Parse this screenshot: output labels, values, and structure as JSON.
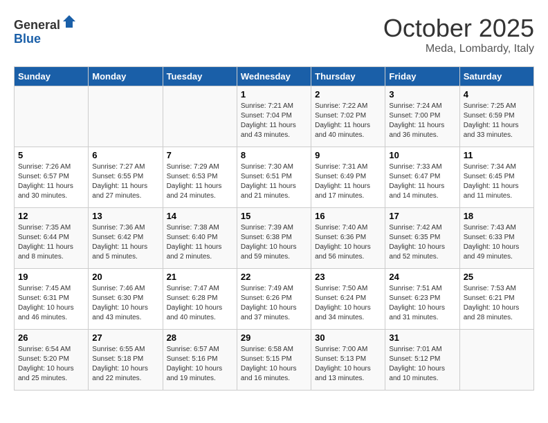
{
  "header": {
    "logo_line1": "General",
    "logo_line2": "Blue",
    "month": "October 2025",
    "location": "Meda, Lombardy, Italy"
  },
  "weekdays": [
    "Sunday",
    "Monday",
    "Tuesday",
    "Wednesday",
    "Thursday",
    "Friday",
    "Saturday"
  ],
  "weeks": [
    [
      {
        "num": "",
        "info": ""
      },
      {
        "num": "",
        "info": ""
      },
      {
        "num": "",
        "info": ""
      },
      {
        "num": "1",
        "info": "Sunrise: 7:21 AM\nSunset: 7:04 PM\nDaylight: 11 hours and 43 minutes."
      },
      {
        "num": "2",
        "info": "Sunrise: 7:22 AM\nSunset: 7:02 PM\nDaylight: 11 hours and 40 minutes."
      },
      {
        "num": "3",
        "info": "Sunrise: 7:24 AM\nSunset: 7:00 PM\nDaylight: 11 hours and 36 minutes."
      },
      {
        "num": "4",
        "info": "Sunrise: 7:25 AM\nSunset: 6:59 PM\nDaylight: 11 hours and 33 minutes."
      }
    ],
    [
      {
        "num": "5",
        "info": "Sunrise: 7:26 AM\nSunset: 6:57 PM\nDaylight: 11 hours and 30 minutes."
      },
      {
        "num": "6",
        "info": "Sunrise: 7:27 AM\nSunset: 6:55 PM\nDaylight: 11 hours and 27 minutes."
      },
      {
        "num": "7",
        "info": "Sunrise: 7:29 AM\nSunset: 6:53 PM\nDaylight: 11 hours and 24 minutes."
      },
      {
        "num": "8",
        "info": "Sunrise: 7:30 AM\nSunset: 6:51 PM\nDaylight: 11 hours and 21 minutes."
      },
      {
        "num": "9",
        "info": "Sunrise: 7:31 AM\nSunset: 6:49 PM\nDaylight: 11 hours and 17 minutes."
      },
      {
        "num": "10",
        "info": "Sunrise: 7:33 AM\nSunset: 6:47 PM\nDaylight: 11 hours and 14 minutes."
      },
      {
        "num": "11",
        "info": "Sunrise: 7:34 AM\nSunset: 6:45 PM\nDaylight: 11 hours and 11 minutes."
      }
    ],
    [
      {
        "num": "12",
        "info": "Sunrise: 7:35 AM\nSunset: 6:44 PM\nDaylight: 11 hours and 8 minutes."
      },
      {
        "num": "13",
        "info": "Sunrise: 7:36 AM\nSunset: 6:42 PM\nDaylight: 11 hours and 5 minutes."
      },
      {
        "num": "14",
        "info": "Sunrise: 7:38 AM\nSunset: 6:40 PM\nDaylight: 11 hours and 2 minutes."
      },
      {
        "num": "15",
        "info": "Sunrise: 7:39 AM\nSunset: 6:38 PM\nDaylight: 10 hours and 59 minutes."
      },
      {
        "num": "16",
        "info": "Sunrise: 7:40 AM\nSunset: 6:36 PM\nDaylight: 10 hours and 56 minutes."
      },
      {
        "num": "17",
        "info": "Sunrise: 7:42 AM\nSunset: 6:35 PM\nDaylight: 10 hours and 52 minutes."
      },
      {
        "num": "18",
        "info": "Sunrise: 7:43 AM\nSunset: 6:33 PM\nDaylight: 10 hours and 49 minutes."
      }
    ],
    [
      {
        "num": "19",
        "info": "Sunrise: 7:45 AM\nSunset: 6:31 PM\nDaylight: 10 hours and 46 minutes."
      },
      {
        "num": "20",
        "info": "Sunrise: 7:46 AM\nSunset: 6:30 PM\nDaylight: 10 hours and 43 minutes."
      },
      {
        "num": "21",
        "info": "Sunrise: 7:47 AM\nSunset: 6:28 PM\nDaylight: 10 hours and 40 minutes."
      },
      {
        "num": "22",
        "info": "Sunrise: 7:49 AM\nSunset: 6:26 PM\nDaylight: 10 hours and 37 minutes."
      },
      {
        "num": "23",
        "info": "Sunrise: 7:50 AM\nSunset: 6:24 PM\nDaylight: 10 hours and 34 minutes."
      },
      {
        "num": "24",
        "info": "Sunrise: 7:51 AM\nSunset: 6:23 PM\nDaylight: 10 hours and 31 minutes."
      },
      {
        "num": "25",
        "info": "Sunrise: 7:53 AM\nSunset: 6:21 PM\nDaylight: 10 hours and 28 minutes."
      }
    ],
    [
      {
        "num": "26",
        "info": "Sunrise: 6:54 AM\nSunset: 5:20 PM\nDaylight: 10 hours and 25 minutes."
      },
      {
        "num": "27",
        "info": "Sunrise: 6:55 AM\nSunset: 5:18 PM\nDaylight: 10 hours and 22 minutes."
      },
      {
        "num": "28",
        "info": "Sunrise: 6:57 AM\nSunset: 5:16 PM\nDaylight: 10 hours and 19 minutes."
      },
      {
        "num": "29",
        "info": "Sunrise: 6:58 AM\nSunset: 5:15 PM\nDaylight: 10 hours and 16 minutes."
      },
      {
        "num": "30",
        "info": "Sunrise: 7:00 AM\nSunset: 5:13 PM\nDaylight: 10 hours and 13 minutes."
      },
      {
        "num": "31",
        "info": "Sunrise: 7:01 AM\nSunset: 5:12 PM\nDaylight: 10 hours and 10 minutes."
      },
      {
        "num": "",
        "info": ""
      }
    ]
  ]
}
